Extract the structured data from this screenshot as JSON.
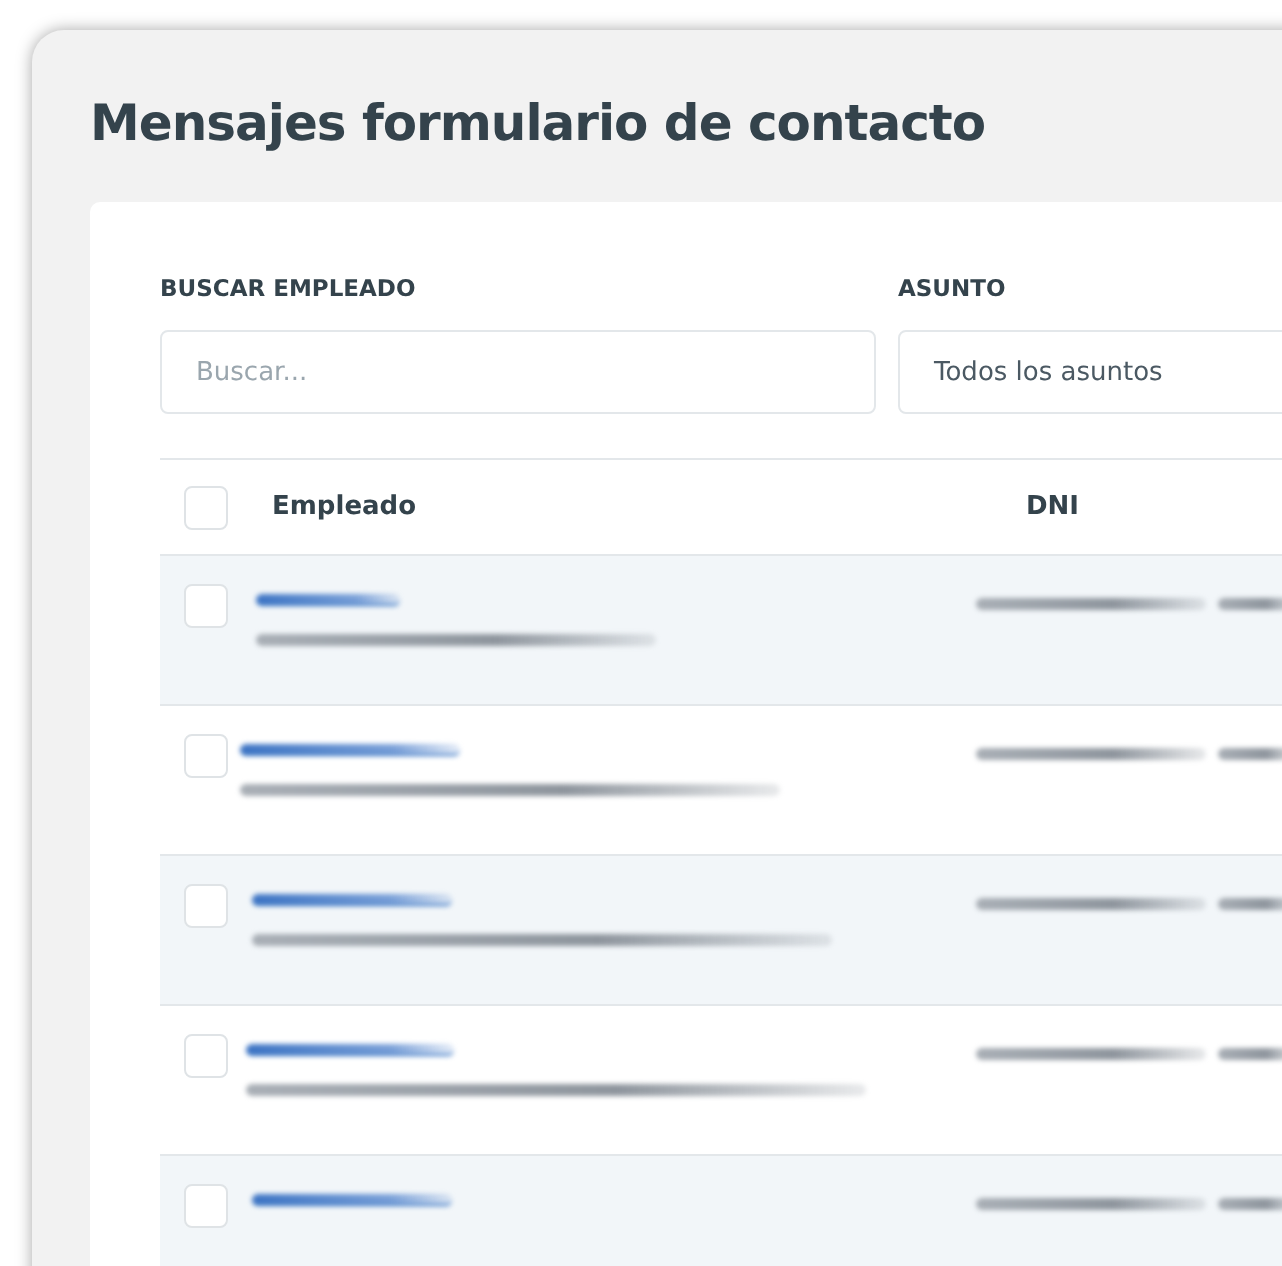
{
  "title": "Mensajes formulario de contacto",
  "filters": [
    {
      "label": "BUSCAR EMPLEADO",
      "kind": "search",
      "placeholder": "Buscar..."
    },
    {
      "label": "ASUNTO",
      "kind": "select",
      "value": "Todos los asuntos"
    }
  ],
  "table": {
    "select_all": {
      "checked": false
    },
    "columns": [
      "Empleado",
      "DNI"
    ],
    "rows": [
      {
        "checked": false
      },
      {
        "checked": false
      },
      {
        "checked": false
      },
      {
        "checked": false
      },
      {
        "checked": false
      }
    ]
  }
}
